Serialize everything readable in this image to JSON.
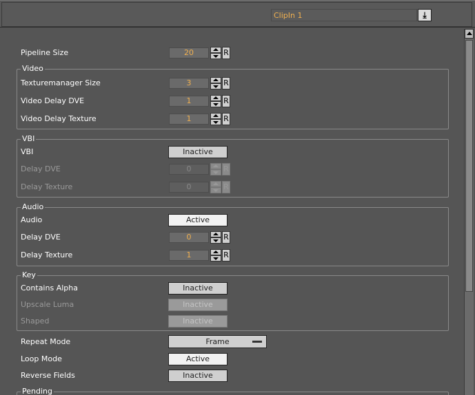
{
  "header": {
    "clip_select": {
      "value": "ClipIn 1"
    },
    "download_icon": "download-arrow-icon"
  },
  "pipeline": {
    "label": "Pipeline Size",
    "value": "20",
    "reset": "R"
  },
  "video": {
    "title": "Video",
    "rows": [
      {
        "label": "Texturemanager Size",
        "value": "3",
        "reset": "R"
      },
      {
        "label": "Video Delay DVE",
        "value": "1",
        "reset": "R"
      },
      {
        "label": "Video Delay Texture",
        "value": "1",
        "reset": "R"
      }
    ]
  },
  "vbi": {
    "title": "VBI",
    "toggle": {
      "label": "VBI",
      "value": "Inactive"
    },
    "rows": [
      {
        "label": "Delay DVE",
        "value": "0",
        "reset": "R"
      },
      {
        "label": "Delay Texture",
        "value": "0",
        "reset": "R"
      }
    ]
  },
  "audio": {
    "title": "Audio",
    "toggle": {
      "label": "Audio",
      "value": "Active"
    },
    "rows": [
      {
        "label": "Delay DVE",
        "value": "0",
        "reset": "R"
      },
      {
        "label": "Delay Texture",
        "value": "1",
        "reset": "R"
      }
    ]
  },
  "key": {
    "title": "Key",
    "contains_alpha": {
      "label": "Contains Alpha",
      "value": "Inactive"
    },
    "upscale_luma": {
      "label": "Upscale Luma",
      "value": "Inactive"
    },
    "shaped": {
      "label": "Shaped",
      "value": "Inactive"
    }
  },
  "repeat_mode": {
    "label": "Repeat Mode",
    "value": "Frame"
  },
  "loop_mode": {
    "label": "Loop Mode",
    "value": "Active"
  },
  "reverse_fields": {
    "label": "Reverse Fields",
    "value": "Inactive"
  },
  "pending": {
    "title": "Pending"
  },
  "colors": {
    "accent_value": "#f0b050",
    "background": "#555555"
  }
}
